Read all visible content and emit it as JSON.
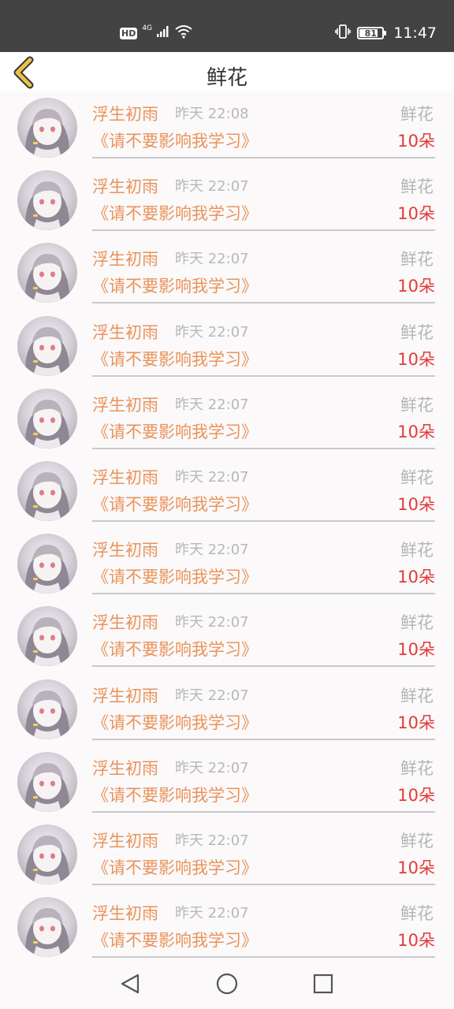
{
  "status_bar": {
    "hd": "HD",
    "network": "4G",
    "battery_level": "81",
    "battery_fraction": 0.81,
    "time": "11:47",
    "icons": [
      "signal-icon",
      "wifi-icon",
      "vibrate-icon",
      "battery-icon"
    ]
  },
  "header": {
    "title": "鲜花",
    "back_icon": "chevron-left-icon"
  },
  "list": {
    "items": [
      {
        "user": "浮生初雨",
        "time": "昨天 22:08",
        "type": "鲜花",
        "book": "《请不要影响我学习》",
        "count": "10朵"
      },
      {
        "user": "浮生初雨",
        "time": "昨天 22:07",
        "type": "鲜花",
        "book": "《请不要影响我学习》",
        "count": "10朵"
      },
      {
        "user": "浮生初雨",
        "time": "昨天 22:07",
        "type": "鲜花",
        "book": "《请不要影响我学习》",
        "count": "10朵"
      },
      {
        "user": "浮生初雨",
        "time": "昨天 22:07",
        "type": "鲜花",
        "book": "《请不要影响我学习》",
        "count": "10朵"
      },
      {
        "user": "浮生初雨",
        "time": "昨天 22:07",
        "type": "鲜花",
        "book": "《请不要影响我学习》",
        "count": "10朵"
      },
      {
        "user": "浮生初雨",
        "time": "昨天 22:07",
        "type": "鲜花",
        "book": "《请不要影响我学习》",
        "count": "10朵"
      },
      {
        "user": "浮生初雨",
        "time": "昨天 22:07",
        "type": "鲜花",
        "book": "《请不要影响我学习》",
        "count": "10朵"
      },
      {
        "user": "浮生初雨",
        "time": "昨天 22:07",
        "type": "鲜花",
        "book": "《请不要影响我学习》",
        "count": "10朵"
      },
      {
        "user": "浮生初雨",
        "time": "昨天 22:07",
        "type": "鲜花",
        "book": "《请不要影响我学习》",
        "count": "10朵"
      },
      {
        "user": "浮生初雨",
        "time": "昨天 22:07",
        "type": "鲜花",
        "book": "《请不要影响我学习》",
        "count": "10朵"
      },
      {
        "user": "浮生初雨",
        "time": "昨天 22:07",
        "type": "鲜花",
        "book": "《请不要影响我学习》",
        "count": "10朵"
      },
      {
        "user": "浮生初雨",
        "time": "昨天 22:07",
        "type": "鲜花",
        "book": "《请不要影响我学习》",
        "count": "10朵"
      }
    ]
  },
  "nav_bar": {
    "icons": [
      "back-triangle-icon",
      "home-circle-icon",
      "recents-square-icon"
    ]
  },
  "colors": {
    "status_bar_bg": "#434343",
    "accent_orange": "#e9935c",
    "count_red": "#e23a3a",
    "back_chevron_yellow": "#e9c24a",
    "muted_gray": "#b8b8b8"
  }
}
